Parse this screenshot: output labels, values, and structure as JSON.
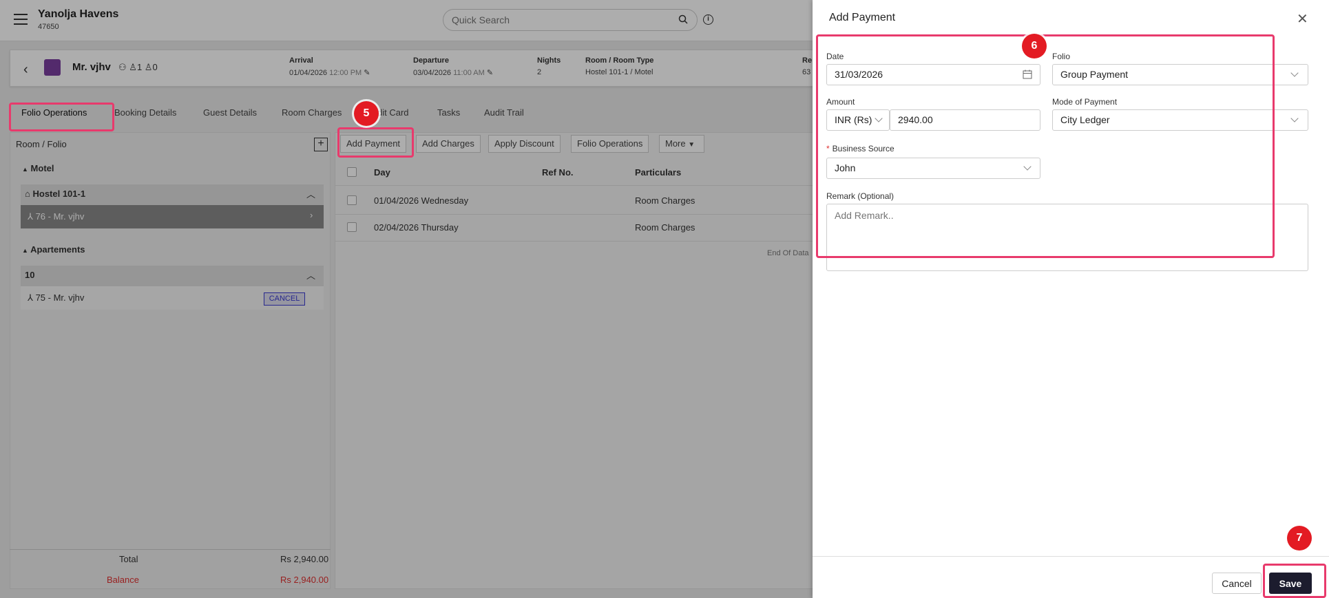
{
  "app": {
    "hotel_name": "Yanolja Havens",
    "hotel_id": "47650",
    "search_placeholder": "Quick Search"
  },
  "guest": {
    "name": "Mr. vjhv",
    "adults": "1",
    "children": "0",
    "arrival_label": "Arrival",
    "arrival_date": "01/04/2026",
    "arrival_time": "12:00 PM",
    "departure_label": "Departure",
    "departure_date": "03/04/2026",
    "departure_time": "11:00 AM",
    "nights_label": "Nights",
    "nights": "2",
    "room_label": "Room / Room Type",
    "room": "Hostel 101-1 / Motel",
    "res_label_partial": "Re",
    "res_val_partial": "63"
  },
  "tabs": [
    "Folio Operations",
    "Booking Details",
    "Guest Details",
    "Room Charges",
    "dit Card",
    "Tasks",
    "Audit Trail"
  ],
  "left": {
    "header": "Room / Folio",
    "groups": [
      {
        "name": "Motel",
        "room": "Hostel 101-1",
        "folio": "76 - Mr. vjhv"
      },
      {
        "name": "Apartements",
        "room": "10",
        "folio": "75 - Mr. vjhv",
        "tag": "CANCEL"
      }
    ],
    "total_label": "Total",
    "total_value": "Rs 2,940.00",
    "balance_label": "Balance",
    "balance_value": "Rs 2,940.00"
  },
  "toolbar": {
    "add_payment": "Add Payment",
    "add_charges": "Add Charges",
    "apply_discount": "Apply Discount",
    "folio_operations": "Folio Operations",
    "more": "More"
  },
  "table": {
    "headers": [
      "Day",
      "Ref No.",
      "Particulars"
    ],
    "rows": [
      {
        "day": "01/04/2026 Wednesday",
        "particulars": "Room Charges"
      },
      {
        "day": "02/04/2026 Thursday",
        "particulars": "Room Charges"
      }
    ],
    "end_text": "End Of Data"
  },
  "drawer": {
    "title": "Add Payment",
    "date_label": "Date",
    "date_value": "31/03/2026",
    "folio_label": "Folio",
    "folio_value": "Group Payment",
    "amount_label": "Amount",
    "currency": "INR (Rs)",
    "amount_value": "2940.00",
    "mode_label": "Mode of Payment",
    "mode_value": "City Ledger",
    "source_label": "Business Source",
    "source_value": "John",
    "remark_label": "Remark (Optional)",
    "remark_placeholder": "Add Remark..",
    "cancel": "Cancel",
    "save": "Save"
  },
  "steps": [
    "5",
    "6",
    "7"
  ],
  "colors": {
    "highlight": "#e83a6c",
    "badge": "#e31b23",
    "save_bg": "#1c1c2e",
    "balance": "#e03030"
  }
}
